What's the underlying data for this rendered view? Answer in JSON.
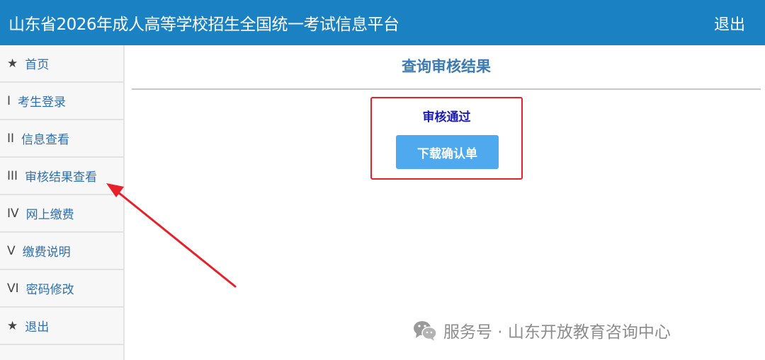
{
  "header": {
    "title": "山东省2026年成人高等学校招生全国统一考试信息平台",
    "logout": "退出"
  },
  "sidebar": {
    "items": [
      {
        "num": "★",
        "label": "首页"
      },
      {
        "num": "I",
        "label": "考生登录"
      },
      {
        "num": "II",
        "label": "信息查看"
      },
      {
        "num": "III",
        "label": "审核结果查看"
      },
      {
        "num": "IV",
        "label": "网上缴费"
      },
      {
        "num": "V",
        "label": "缴费说明"
      },
      {
        "num": "VI",
        "label": "密码修改"
      },
      {
        "num": "★",
        "label": "退出"
      }
    ]
  },
  "main": {
    "title": "查询审核结果",
    "status": "审核通过",
    "download_button": "下载确认单"
  },
  "annotation": {
    "arrow_color": "#e8202a",
    "box_color": "#e8202a"
  },
  "watermark": {
    "text": "服务号 · 山东开放教育咨询中心",
    "icon": "wechat-icon"
  }
}
